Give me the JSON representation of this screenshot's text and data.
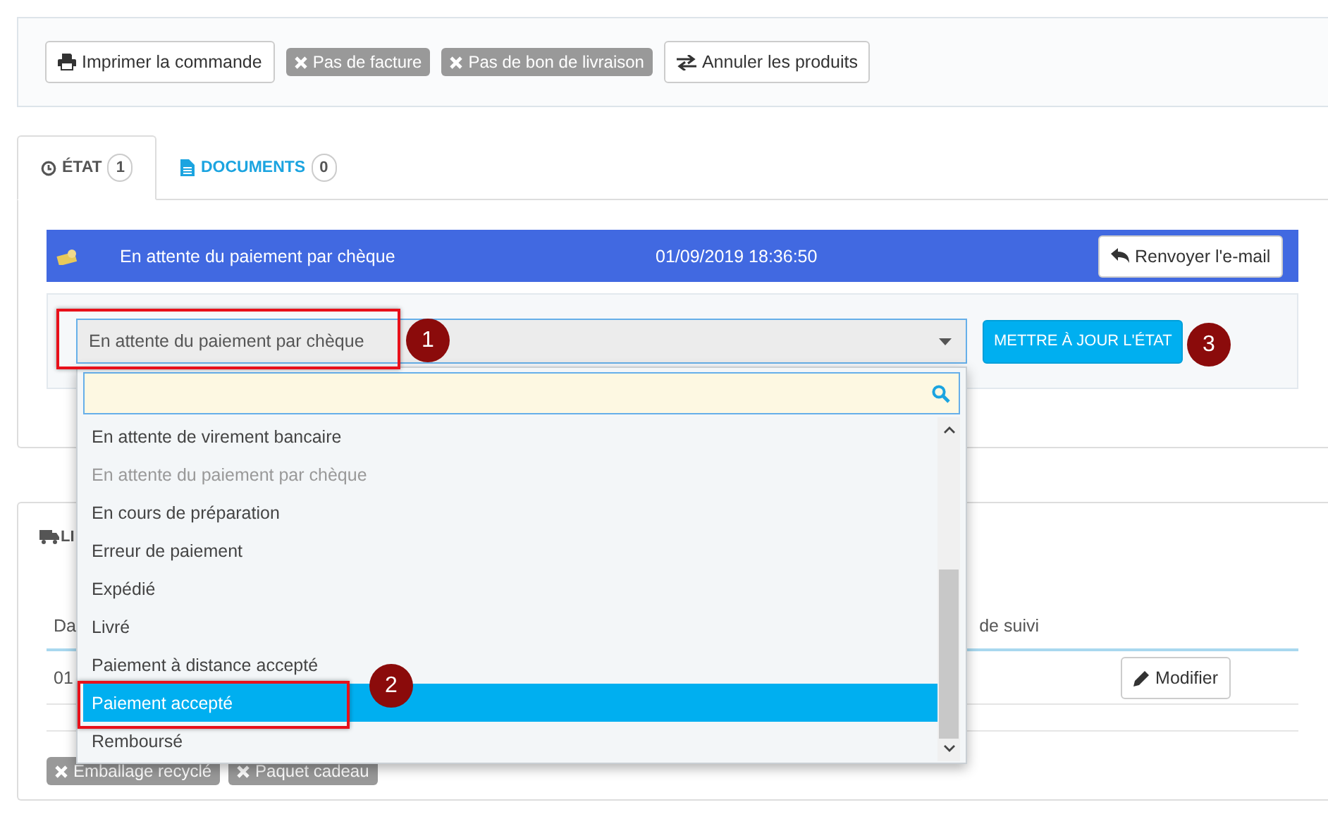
{
  "toolbar": {
    "items": [
      {
        "kind": "button",
        "label": "Imprimer la commande"
      },
      {
        "kind": "badge",
        "label": "Pas de facture"
      },
      {
        "kind": "badge",
        "label": "Pas de bon de livraison"
      },
      {
        "kind": "button",
        "label": "Annuler les produits"
      }
    ]
  },
  "tabs": [
    {
      "label": "ÉTAT",
      "count": "1",
      "selected": true
    },
    {
      "label": "DOCUMENTS",
      "count": "0",
      "selected": false
    }
  ],
  "history_row": {
    "status": "En attente du paiement par chèque",
    "date": "01/09/2019 18:36:50",
    "button": "Renvoyer l'e-mail"
  },
  "status_form": {
    "value": "En attente du paiement par chèque",
    "button": "METTRE À JOUR L'ÉTAT"
  },
  "dropdown": {
    "options": [
      {
        "label": "En attente de virement bancaire",
        "disabled": false,
        "selected": false
      },
      {
        "label": "En attente du paiement par chèque",
        "disabled": true,
        "selected": false
      },
      {
        "label": "En cours de préparation",
        "disabled": false,
        "selected": false
      },
      {
        "label": "Erreur de paiement",
        "disabled": false,
        "selected": false
      },
      {
        "label": "Expédié",
        "disabled": false,
        "selected": false
      },
      {
        "label": "Livré",
        "disabled": false,
        "selected": false
      },
      {
        "label": "Paiement à distance accepté",
        "disabled": false,
        "selected": false
      },
      {
        "label": "Paiement accepté",
        "disabled": false,
        "selected": true
      },
      {
        "label": "Remboursé",
        "disabled": false,
        "selected": false
      }
    ]
  },
  "shipping_panel": {
    "title": "LI",
    "columns": [
      "Da",
      "de suivi"
    ],
    "rows": [
      {
        "cells": [
          "01"
        ],
        "button": "Modifier"
      }
    ],
    "badges": [
      "Emballage recyclé",
      "Paquet cadeau"
    ]
  },
  "annotations": [
    {
      "number": "1"
    },
    {
      "number": "2"
    },
    {
      "number": "3"
    }
  ]
}
